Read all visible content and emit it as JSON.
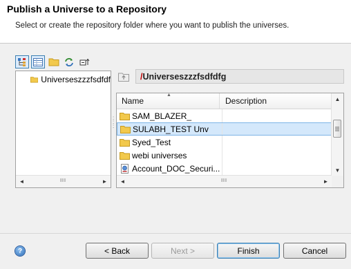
{
  "header": {
    "title": "Publish a Universe to a Repository",
    "subtitle": "Select or create the repository folder where you want to publish the universes."
  },
  "toolbar": {
    "buttons": [
      "tree-view-icon",
      "details-view-icon",
      "new-folder-icon",
      "refresh-icon",
      "collapse-all-icon"
    ]
  },
  "tree": {
    "items": [
      {
        "label": "Universeszzzfsdfdf",
        "icon": "folder-icon"
      }
    ]
  },
  "path": {
    "value": "/Universeszzzfsdfdfg",
    "icon": "up-folder-icon"
  },
  "table": {
    "columns": [
      "Name",
      "Description"
    ],
    "rows": [
      {
        "name": "SAM_BLAZER_",
        "description": "",
        "icon": "folder-icon"
      },
      {
        "name": "SULABH_TEST Unv",
        "description": "",
        "icon": "folder-icon",
        "selected": true
      },
      {
        "name": "Syed_Test",
        "description": "",
        "icon": "folder-icon"
      },
      {
        "name": "webi universes",
        "description": "",
        "icon": "folder-icon"
      },
      {
        "name": "Account_DOC_Securi...",
        "description": "",
        "icon": "universe-file-icon"
      }
    ]
  },
  "buttons": {
    "back": "< Back",
    "next": "Next >",
    "finish": "Finish",
    "cancel": "Cancel"
  },
  "scroll": {
    "left_arrow": "◄",
    "right_arrow": "►",
    "up_arrow": "▲",
    "down_arrow": "▼",
    "grip": "III"
  },
  "colors": {
    "selection": "#d4e8fb",
    "path_slash": "#c00000",
    "folder": "#f2c94c"
  }
}
